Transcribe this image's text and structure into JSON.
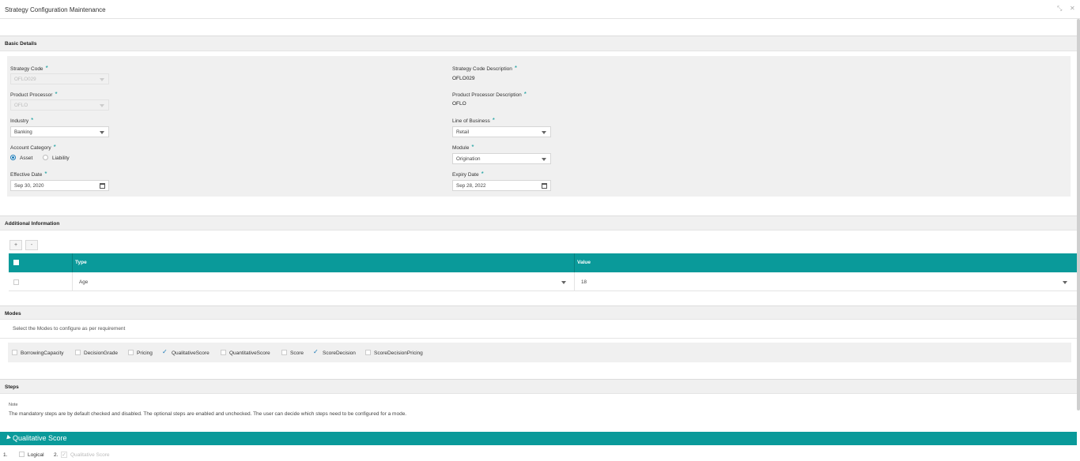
{
  "window": {
    "title": "Strategy Configuration Maintenance",
    "minimize_glyph": "⤡",
    "close_glyph": "✕"
  },
  "basic_details": {
    "heading": "Basic Details",
    "strategy_code": {
      "label": "Strategy Code",
      "value": "OFLO029"
    },
    "strategy_code_description": {
      "label": "Strategy Code Description",
      "value": "OFLO029"
    },
    "product_processor": {
      "label": "Product Processor",
      "value": "OFLO"
    },
    "product_processor_description": {
      "label": "Product Processor Description",
      "value": "OFLO"
    },
    "industry": {
      "label": "Industry",
      "value": "Banking"
    },
    "line_of_business": {
      "label": "Line of Business",
      "value": "Retail"
    },
    "account_category": {
      "label": "Account Category",
      "options": [
        "Asset",
        "Liability"
      ],
      "selected": "Asset"
    },
    "module": {
      "label": "Module",
      "value": "Origination"
    },
    "effective_date": {
      "label": "Effective Date",
      "value": "Sep 30, 2020"
    },
    "expiry_date": {
      "label": "Expiry Date",
      "value": "Sep 28, 2022"
    },
    "required_marker": "*"
  },
  "additional_information": {
    "heading": "Additional Information",
    "add_label": "+",
    "remove_label": "-",
    "columns": [
      "Type",
      "Value"
    ],
    "rows": [
      {
        "type": "Age",
        "value": "18"
      }
    ]
  },
  "modes": {
    "heading": "Modes",
    "instruction": "Select the Modes to configure as per requirement",
    "items": [
      {
        "label": "BorrowingCapacity",
        "checked": false
      },
      {
        "label": "DecisionGrade",
        "checked": false
      },
      {
        "label": "Pricing",
        "checked": false
      },
      {
        "label": "QualitativeScore",
        "checked": true
      },
      {
        "label": "QuantitativeScore",
        "checked": false
      },
      {
        "label": "Score",
        "checked": false
      },
      {
        "label": "ScoreDecision",
        "checked": true
      },
      {
        "label": "ScoreDecisionPricing",
        "checked": false
      }
    ]
  },
  "steps": {
    "heading": "Steps",
    "note_label": "Note",
    "note_text": "The mandatory steps are by default checked and disabled. The optional steps are enabled and unchecked. The user can decide which steps need to be configured for a mode."
  },
  "qualitative_score": {
    "title": "Qualitative Score",
    "steps": [
      {
        "index": "1.",
        "label": "Logical",
        "checked": false,
        "disabled": false
      },
      {
        "index": "2.",
        "label": "Qualitative Score",
        "checked": true,
        "disabled": true
      }
    ]
  },
  "colors": {
    "accent": "#0a9a9a",
    "section_bg": "#f0f0f0",
    "check": "#1a7ab8"
  }
}
